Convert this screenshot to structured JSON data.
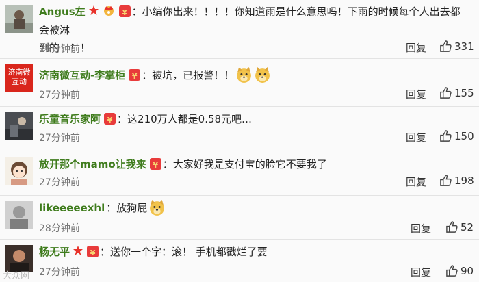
{
  "comments": [
    {
      "username": "Angus左",
      "text": "小编你出来！！！！你知道雨是什么意思吗！下雨的时候每个人出去都会被淋",
      "text2": "到的！！！",
      "time": "26分钟前",
      "reply_label": "回复",
      "likes": "331",
      "badges": [
        "star-icon",
        "crown-vip-icon",
        "red-packet-icon"
      ]
    },
    {
      "username": "济南微互动-李掌柜",
      "avatar_text": "济南微互动",
      "text": "被坑，已报警！！",
      "time": "27分钟前",
      "reply_label": "回复",
      "likes": "155",
      "badges": [
        "red-packet-icon"
      ],
      "emojis": [
        "doge-emoji",
        "doge-emoji"
      ]
    },
    {
      "username": "乐童音乐家阿",
      "text": "这210万人都是0.58元吧…",
      "time": "27分钟前",
      "reply_label": "回复",
      "likes": "150",
      "badges": [
        "red-packet-icon"
      ]
    },
    {
      "username": "放开那个mamo让我来",
      "text": "大家好我是支付宝的脸它不要我了",
      "time": "27分钟前",
      "reply_label": "回复",
      "likes": "198",
      "badges": [
        "red-packet-icon"
      ]
    },
    {
      "username": "likeeeeexhl",
      "text": "放狗屁",
      "time": "28分钟前",
      "reply_label": "回复",
      "likes": "52",
      "badges": [],
      "emojis": [
        "doge-emoji"
      ]
    },
    {
      "username": "杨无平",
      "text": "送你一个字：滚！ 手机都戳烂了要",
      "time": "27分钟前",
      "reply_label": "回复",
      "likes": "90",
      "badges": [
        "star-icon",
        "red-packet-icon"
      ]
    }
  ],
  "colors": {
    "username": "#3f7c1d",
    "background": "#fafafa",
    "red_packet": "#e83b3b",
    "star": "#e8322a",
    "divider": "#e3e3e3"
  },
  "watermark": "大众网"
}
